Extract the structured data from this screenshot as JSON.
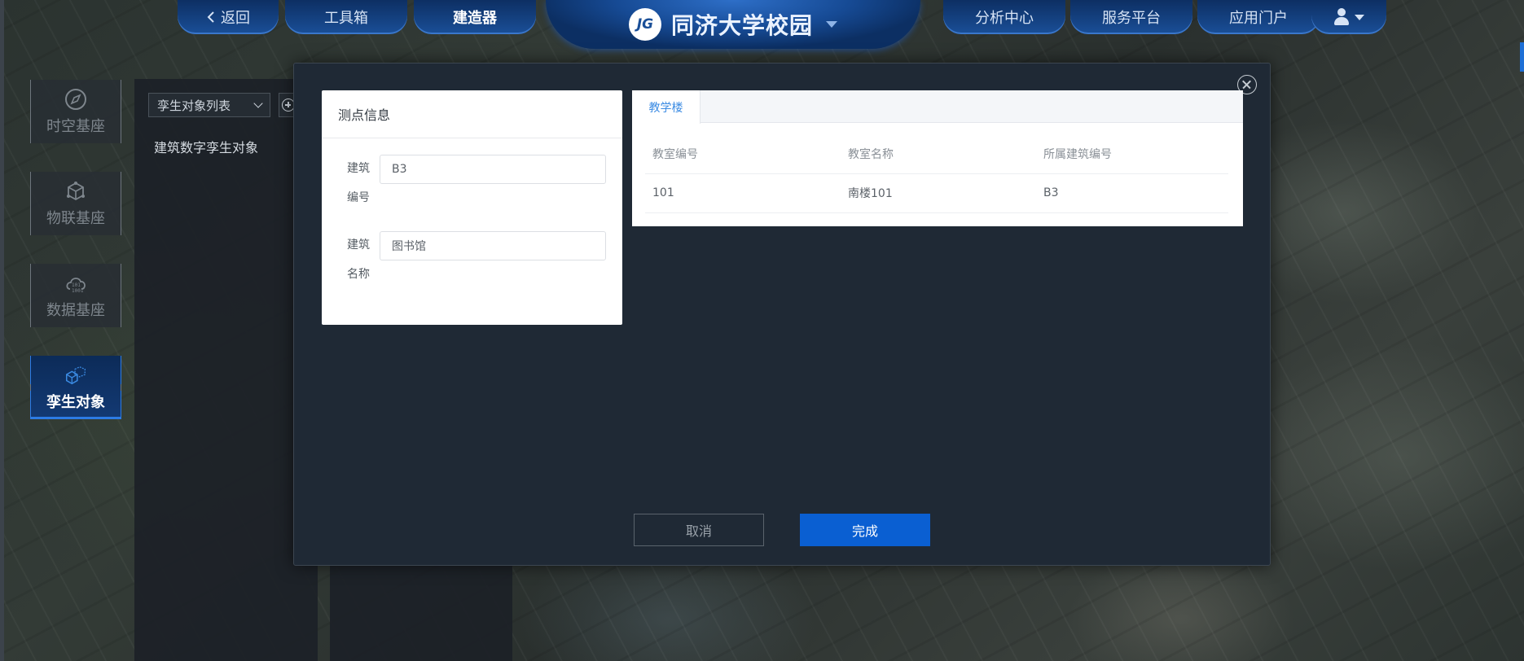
{
  "topnav": {
    "back_label": "返回",
    "toolbox_label": "工具箱",
    "builder_label": "建造器",
    "center_title": "同济大学校园",
    "logo_text": "JG",
    "analysis_label": "分析中心",
    "service_label": "服务平台",
    "portal_label": "应用门户"
  },
  "leftnav": {
    "items": [
      {
        "label": "时空基座",
        "icon": "compass-icon"
      },
      {
        "label": "物联基座",
        "icon": "iot-cube-icon"
      },
      {
        "label": "数据基座",
        "icon": "data-cloud-icon"
      },
      {
        "label": "孪生对象",
        "icon": "twin-cubes-icon",
        "active": true
      }
    ]
  },
  "side_panel": {
    "select_value": "孪生对象列表",
    "tree_node": "建筑数字孪生对象"
  },
  "modal": {
    "info_title": "测点信息",
    "fields": [
      {
        "label": "建筑编号",
        "value": "B3"
      },
      {
        "label": "建筑名称",
        "value": "图书馆"
      }
    ],
    "tab_label": "教学楼",
    "table": {
      "headers": [
        "教室编号",
        "教室名称",
        "所属建筑编号"
      ],
      "rows": [
        [
          "101",
          "南楼101",
          "B3"
        ]
      ]
    },
    "cancel_label": "取消",
    "done_label": "完成"
  },
  "colors": {
    "accent": "#0a5fd2",
    "nav_blue": "#1a4f98",
    "tab_active": "#3b8be3"
  }
}
